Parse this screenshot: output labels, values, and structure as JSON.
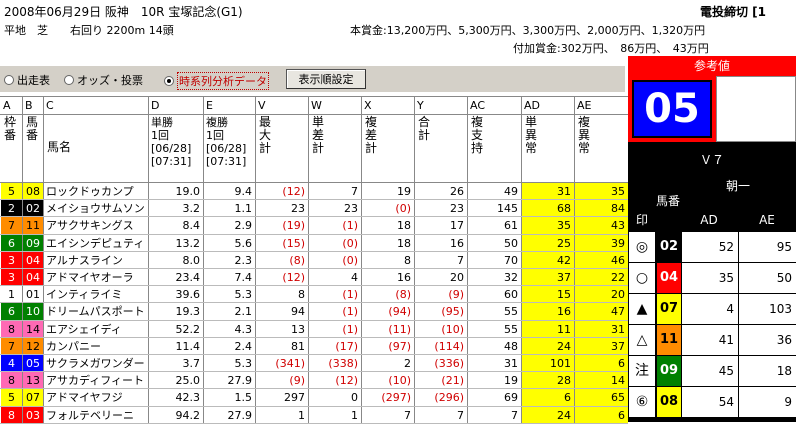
{
  "header": {
    "race_line": "2008年06月29日 阪神　10R 宝塚記念(G1)",
    "deadline": "電投締切 [1",
    "course": "平地　芝　　右回り 2200m 14頭",
    "prize": "本賞金:13,200万円、5,300万円、3,300万円、2,000万円、1,320万円",
    "add_prize": "付加賞金:302万円、　86万円、　43万円"
  },
  "controls": {
    "radio1": "出走表",
    "radio2": "オッズ・投票",
    "radio3": "時系列分析データ",
    "button": "表示順設定"
  },
  "columns": {
    "letters": [
      "A",
      "B",
      "C",
      "D",
      "E",
      "V",
      "W",
      "X",
      "Y",
      "AC",
      "AD",
      "AE"
    ],
    "waku": "枠番",
    "uma": "馬番",
    "name": "馬名",
    "tan": [
      "単勝",
      "1回",
      "[06/28]",
      "[07:31]"
    ],
    "fuku": [
      "複勝",
      "1回",
      "[06/28]",
      "[07:31]"
    ],
    "v": "最大計",
    "w": "単差計",
    "x": "複差計",
    "y": "合計",
    "ac": "複支持",
    "ad": "単異常",
    "ae": "複異常"
  },
  "rows": [
    {
      "w": "5",
      "u": "08",
      "n": "ロックドゥカンプ",
      "d": "19.0",
      "e": "9.4",
      "v": "(12)",
      "wv": "7",
      "x": "19",
      "y": "26",
      "ac": "49",
      "ad": "31",
      "ae": "35",
      "wc": "#ffff00"
    },
    {
      "w": "2",
      "u": "02",
      "n": "メイショウサムソン",
      "d": "3.2",
      "e": "1.1",
      "v": "23",
      "wv": "23",
      "x": "(0)",
      "y": "23",
      "ac": "145",
      "ad": "68",
      "ae": "84",
      "wc": "#000000"
    },
    {
      "w": "7",
      "u": "11",
      "n": "アサクサキングス",
      "d": "8.4",
      "e": "2.9",
      "v": "(19)",
      "wv": "(1)",
      "x": "18",
      "y": "17",
      "ac": "61",
      "ad": "35",
      "ae": "43",
      "wc": "#ff8c00"
    },
    {
      "w": "6",
      "u": "09",
      "n": "エイシンデピュティ",
      "d": "13.2",
      "e": "5.6",
      "v": "(15)",
      "wv": "(0)",
      "x": "18",
      "y": "16",
      "ac": "50",
      "ad": "25",
      "ae": "39",
      "wc": "#008000"
    },
    {
      "w": "3",
      "u": "04",
      "n": "アルナスライン",
      "d": "8.0",
      "e": "2.3",
      "v": "(8)",
      "wv": "(0)",
      "x": "8",
      "y": "7",
      "ac": "70",
      "ad": "42",
      "ae": "46",
      "wc": "#ff0000"
    },
    {
      "w": "3",
      "u": "04",
      "n": "アドマイヤオーラ",
      "d": "23.4",
      "e": "7.4",
      "v": "(12)",
      "wv": "4",
      "x": "16",
      "y": "20",
      "ac": "32",
      "ad": "37",
      "ae": "22",
      "wc": "#ff0000"
    },
    {
      "w": "1",
      "u": "01",
      "n": "インティライミ",
      "d": "39.6",
      "e": "5.3",
      "v": "8",
      "wv": "(1)",
      "x": "(8)",
      "y": "(9)",
      "ac": "60",
      "ad": "15",
      "ae": "20",
      "wc": "#ffffff"
    },
    {
      "w": "6",
      "u": "10",
      "n": "ドリームパスポート",
      "d": "19.3",
      "e": "2.1",
      "v": "94",
      "wv": "(1)",
      "x": "(94)",
      "y": "(95)",
      "ac": "55",
      "ad": "16",
      "ae": "47",
      "wc": "#008000"
    },
    {
      "w": "8",
      "u": "14",
      "n": "エアシェイディ",
      "d": "52.2",
      "e": "4.3",
      "v": "13",
      "wv": "(1)",
      "x": "(11)",
      "y": "(10)",
      "ac": "55",
      "ad": "11",
      "ae": "31",
      "wc": "#ff69b4"
    },
    {
      "w": "7",
      "u": "12",
      "n": "カンパニー",
      "d": "11.4",
      "e": "2.4",
      "v": "81",
      "wv": "(17)",
      "x": "(97)",
      "y": "(114)",
      "ac": "48",
      "ad": "24",
      "ae": "37",
      "wc": "#ff8c00"
    },
    {
      "w": "4",
      "u": "05",
      "n": "サクラメガワンダー",
      "d": "3.7",
      "e": "5.3",
      "v": "(341)",
      "wv": "(338)",
      "x": "2",
      "y": "(336)",
      "ac": "31",
      "ad": "101",
      "ae": "6",
      "wc": "#0000ff"
    },
    {
      "w": "8",
      "u": "13",
      "n": "アサカディフィート",
      "d": "25.0",
      "e": "27.9",
      "v": "(9)",
      "wv": "(12)",
      "x": "(10)",
      "y": "(21)",
      "ac": "19",
      "ad": "28",
      "ae": "14",
      "wc": "#ff69b4"
    },
    {
      "w": "5",
      "u": "07",
      "n": "アドマイヤフジ",
      "d": "42.3",
      "e": "1.5",
      "v": "297",
      "wv": "0",
      "x": "(297)",
      "y": "(296)",
      "ac": "69",
      "ad": "6",
      "ae": "65",
      "wc": "#ffff00"
    },
    {
      "w": "8",
      "u": "03",
      "n": "フォルテベリーニ",
      "d": "94.2",
      "e": "27.9",
      "v": "1",
      "wv": "1",
      "x": "7",
      "y": "7",
      "ac": "7",
      "ad": "24",
      "ae": "6",
      "wc": "#ff0000"
    }
  ],
  "panel": {
    "title": "参考値",
    "big": "05",
    "v7": "Ｖ７",
    "asaichi": "朝一",
    "in": "印",
    "uma": "馬番",
    "ad": "AD",
    "ae": "AE",
    "marks": [
      {
        "m": "◎",
        "u": "02",
        "ad": "52",
        "ae": "95",
        "c": "#000000",
        "tc": "#ffffff"
      },
      {
        "m": "○",
        "u": "04",
        "ad": "35",
        "ae": "50",
        "c": "#ff0000",
        "tc": "#ffffff"
      },
      {
        "m": "▲",
        "u": "07",
        "ad": "4",
        "ae": "103",
        "c": "#ffff00",
        "tc": "#000000"
      },
      {
        "m": "△",
        "u": "11",
        "ad": "41",
        "ae": "36",
        "c": "#ff8c00",
        "tc": "#000000"
      },
      {
        "m": "注",
        "u": "09",
        "ad": "45",
        "ae": "18",
        "c": "#008000",
        "tc": "#ffffff"
      },
      {
        "m": "⑥",
        "u": "08",
        "ad": "54",
        "ae": "9",
        "c": "#ffff00",
        "tc": "#000000"
      }
    ]
  }
}
